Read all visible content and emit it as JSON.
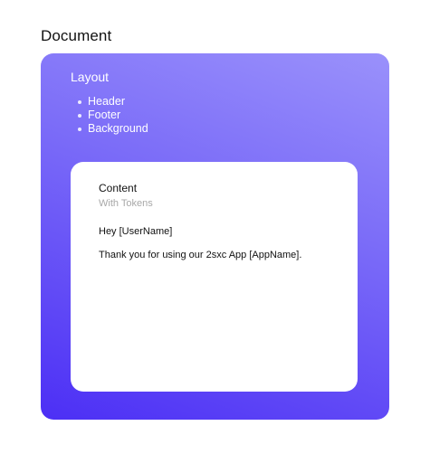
{
  "document": {
    "title": "Document"
  },
  "layout": {
    "title": "Layout",
    "items": [
      "Header",
      "Footer",
      "Background"
    ]
  },
  "content": {
    "title": "Content",
    "subtitle": "With Tokens",
    "greeting": "Hey [UserName]",
    "message": "Thank you for using our 2sxc App [AppName]."
  },
  "colors": {
    "gradient_start": "#9a91fb",
    "gradient_end": "#4c2ff5",
    "card_background": "#ffffff"
  }
}
